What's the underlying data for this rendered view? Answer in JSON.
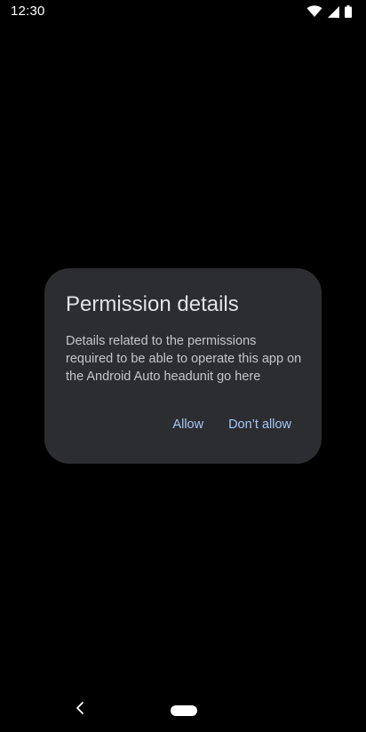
{
  "status_bar": {
    "time": "12:30",
    "icons": [
      "wifi-icon",
      "cell-signal-icon",
      "battery-icon"
    ]
  },
  "dialog": {
    "title": "Permission details",
    "body": "Details related to the permissions required to be able to operate this app on the Android Auto headunit go here",
    "buttons": {
      "allow": "Allow",
      "deny": "Don’t allow"
    }
  },
  "navigation": {
    "icons": [
      "back-icon",
      "home-pill"
    ]
  },
  "colors": {
    "background": "#000000",
    "dialog_surface": "#2c2d30",
    "title_text": "#e3e3e6",
    "body_text": "#c4c6cc",
    "accent": "#a8c7fa"
  }
}
